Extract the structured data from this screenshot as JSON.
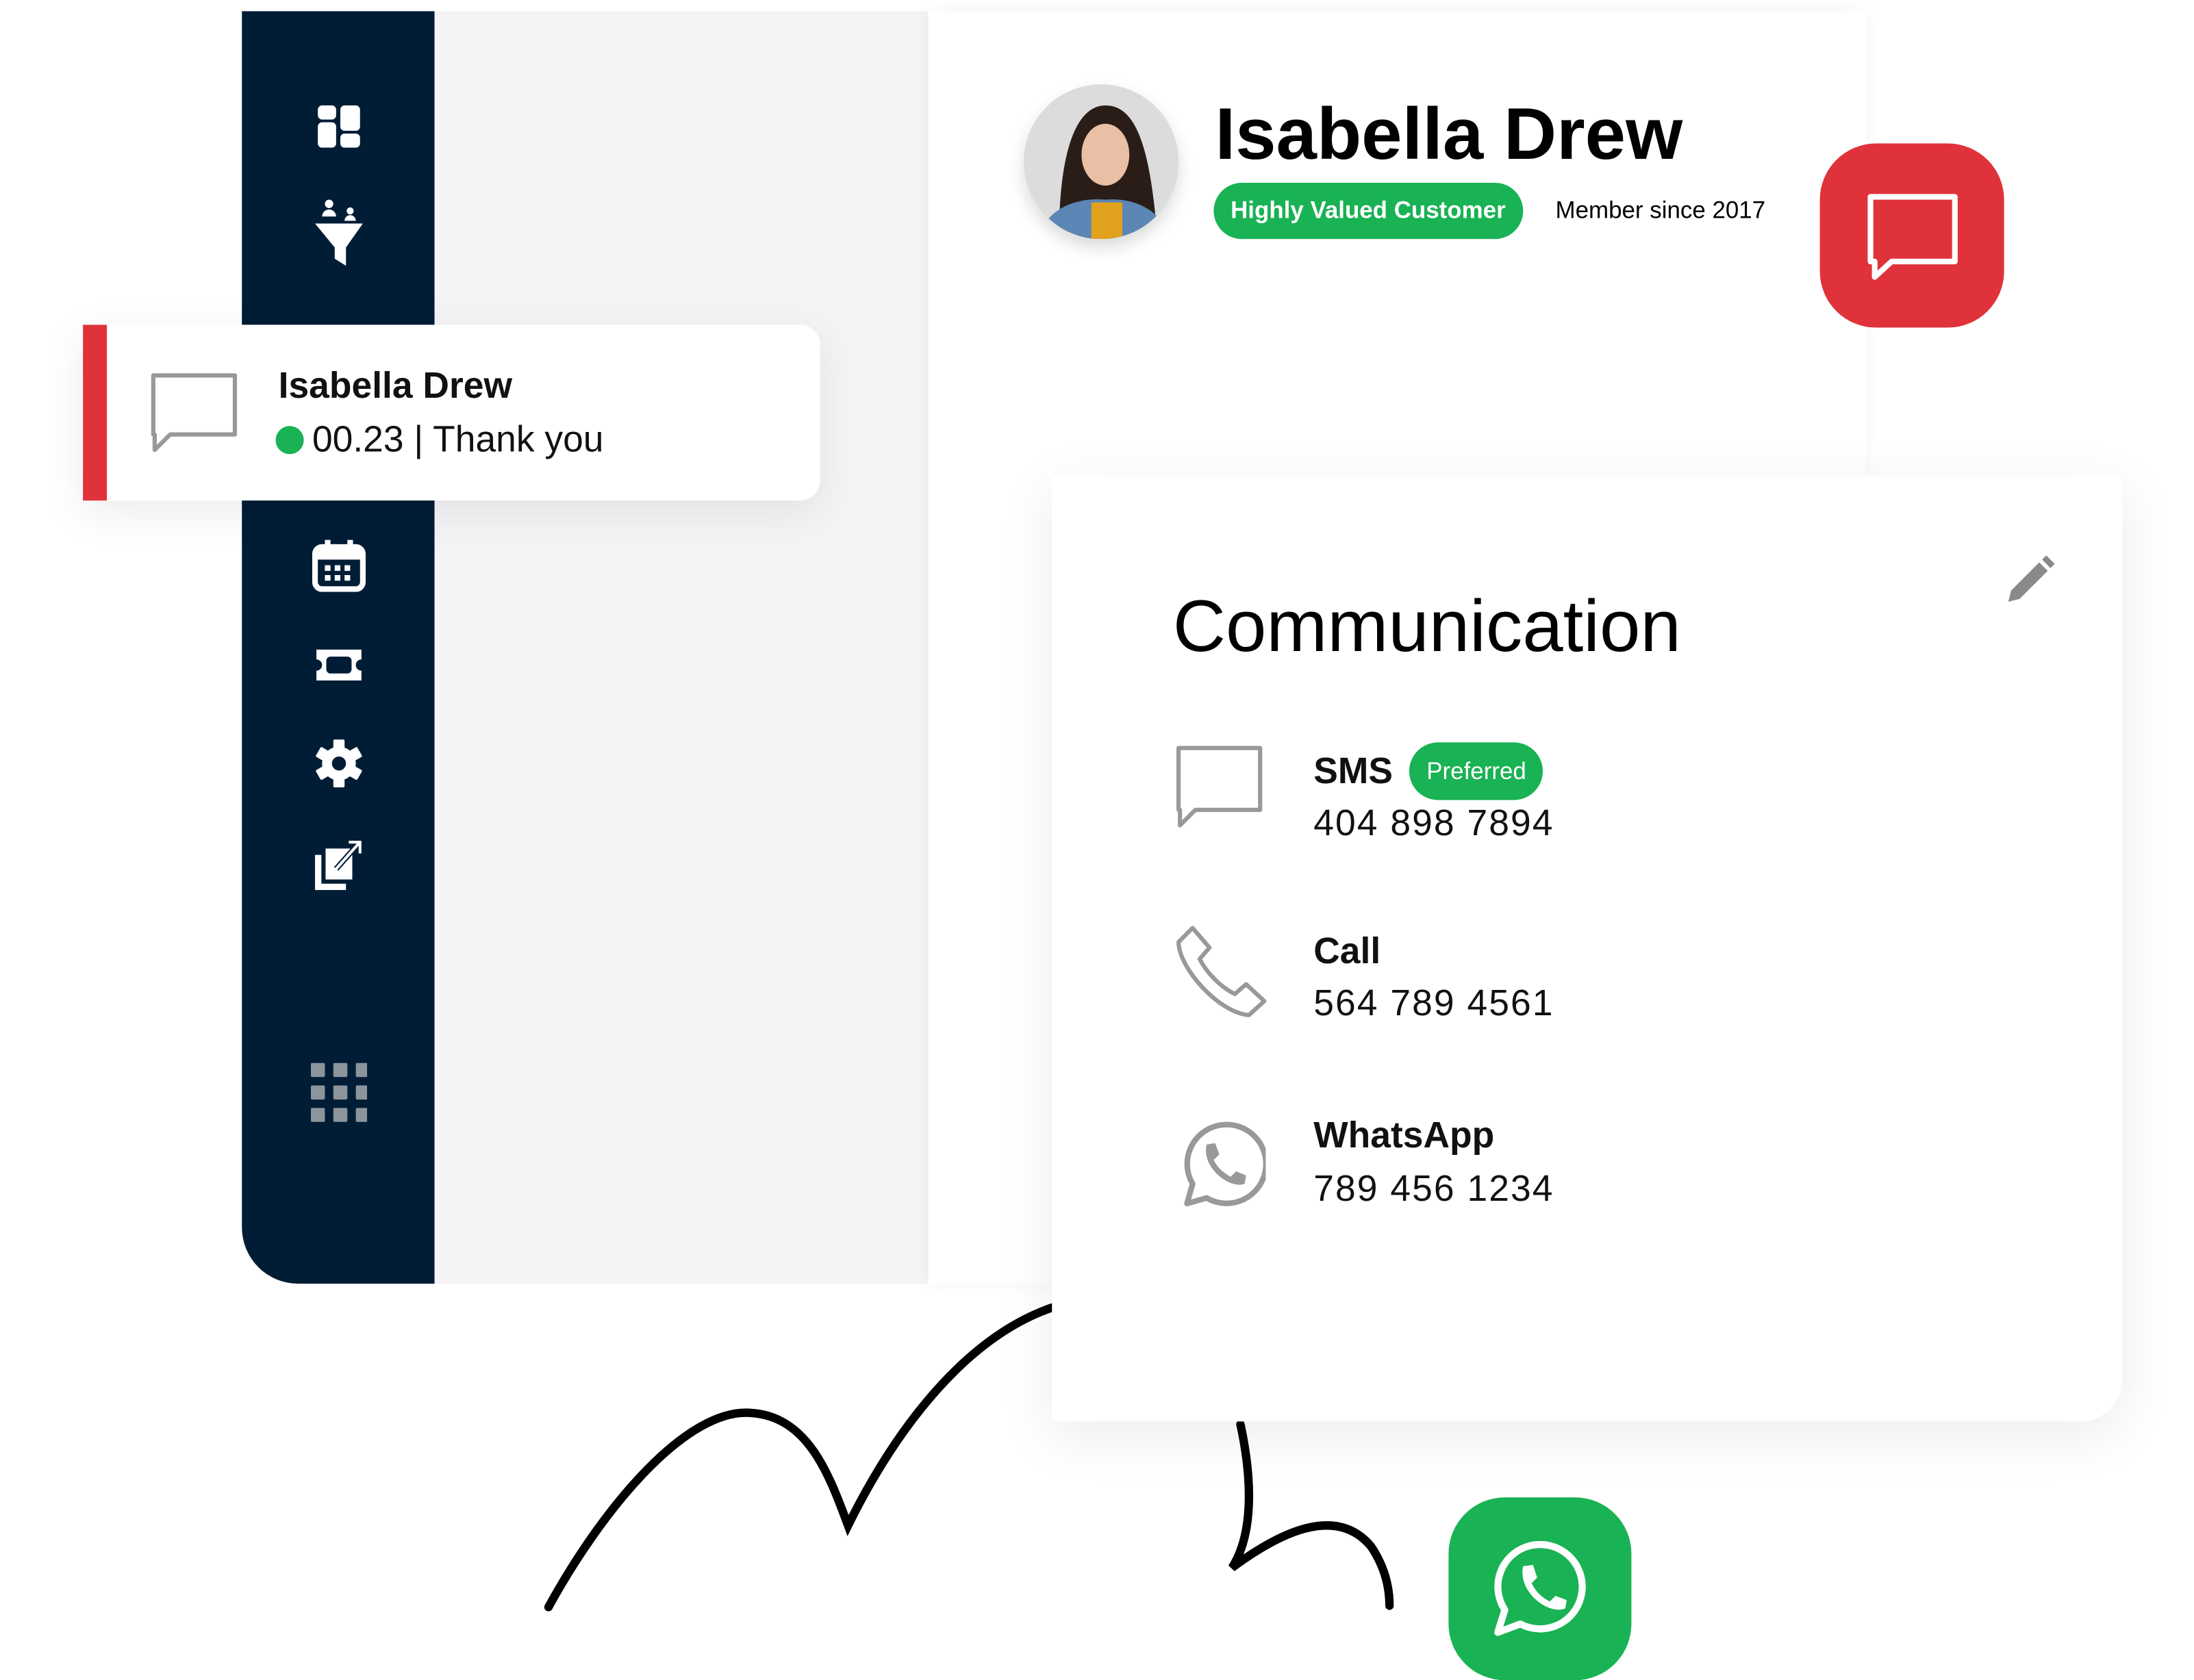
{
  "colors": {
    "sidebar": "#011d36",
    "accent_red": "#e0323a",
    "accent_green": "#19b254",
    "panel_gray": "#f4f4f6"
  },
  "sidebar": {
    "items": [
      {
        "icon": "dashboard-icon"
      },
      {
        "icon": "funnel-icon"
      },
      {
        "icon": "calendar-icon"
      },
      {
        "icon": "ticket-icon"
      },
      {
        "icon": "gear-icon"
      },
      {
        "icon": "export-icon"
      },
      {
        "icon": "apps-grid-icon"
      }
    ]
  },
  "profile": {
    "name": "Isabella Drew",
    "badge": "Highly Valued Customer",
    "member_since": "Member since 2017"
  },
  "notification": {
    "name": "Isabella Drew",
    "status": "00.23 | Thank you"
  },
  "communication": {
    "title": "Communication",
    "channels": [
      {
        "label": "SMS",
        "badge": "Preferred",
        "number": "404 898 7894",
        "icon": "chat-bubble-icon"
      },
      {
        "label": "Call",
        "number": "564 789 4561",
        "icon": "phone-icon"
      },
      {
        "label": "WhatsApp",
        "number": "789 456 1234",
        "icon": "whatsapp-icon"
      }
    ]
  }
}
